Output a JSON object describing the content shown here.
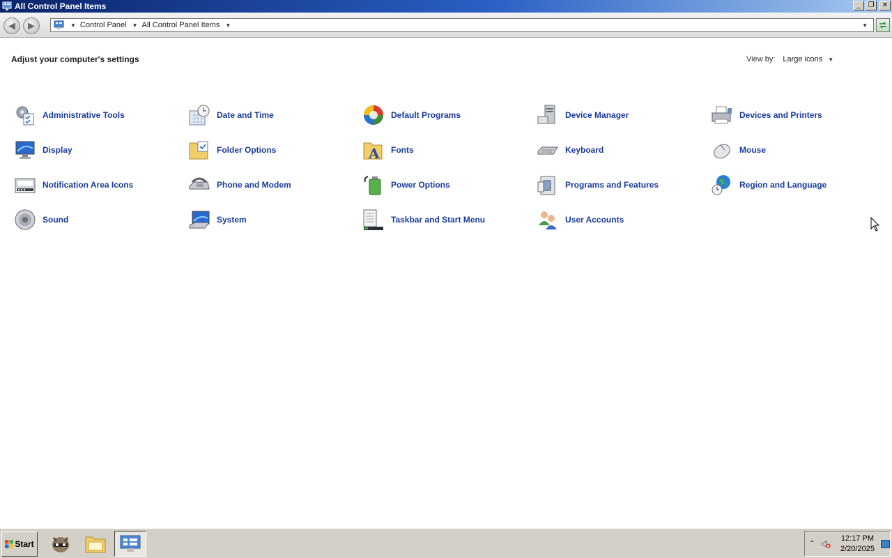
{
  "window": {
    "title": "All Control Panel Items",
    "minimize": "_",
    "maximize": "❐",
    "close": "✕"
  },
  "address": {
    "crumbs": [
      "Control Panel",
      "All Control Panel Items"
    ]
  },
  "content": {
    "heading": "Adjust your computer's settings",
    "view_by_label": "View by:",
    "view_by_value": "Large icons"
  },
  "items": [
    {
      "label": "Administrative Tools",
      "icon": "administrative-tools-icon"
    },
    {
      "label": "Date and Time",
      "icon": "date-time-icon"
    },
    {
      "label": "Default Programs",
      "icon": "default-programs-icon"
    },
    {
      "label": "Device Manager",
      "icon": "device-manager-icon"
    },
    {
      "label": "Devices and Printers",
      "icon": "devices-printers-icon"
    },
    {
      "label": "Display",
      "icon": "display-icon"
    },
    {
      "label": "Folder Options",
      "icon": "folder-options-icon"
    },
    {
      "label": "Fonts",
      "icon": "fonts-icon"
    },
    {
      "label": "Keyboard",
      "icon": "keyboard-icon"
    },
    {
      "label": "Mouse",
      "icon": "mouse-icon"
    },
    {
      "label": "Notification Area Icons",
      "icon": "notification-area-icon"
    },
    {
      "label": "Phone and Modem",
      "icon": "phone-modem-icon"
    },
    {
      "label": "Power Options",
      "icon": "power-options-icon"
    },
    {
      "label": "Programs and Features",
      "icon": "programs-features-icon"
    },
    {
      "label": "Region and Language",
      "icon": "region-language-icon"
    },
    {
      "label": "Sound",
      "icon": "sound-icon"
    },
    {
      "label": "System",
      "icon": "system-icon"
    },
    {
      "label": "Taskbar and Start Menu",
      "icon": "taskbar-start-menu-icon"
    },
    {
      "label": "User Accounts",
      "icon": "user-accounts-icon"
    }
  ],
  "taskbar": {
    "start_label": "Start",
    "apps": [
      {
        "icon": "raccoon-app-icon"
      },
      {
        "icon": "file-explorer-icon"
      },
      {
        "icon": "control-panel-icon",
        "active": true
      }
    ],
    "tray": {
      "time": "12:17 PM",
      "date": "2/20/2025"
    }
  },
  "colors": {
    "link": "#1a3c9a",
    "title_bar": "#0a246a",
    "taskbar": "#d4d0c8"
  }
}
